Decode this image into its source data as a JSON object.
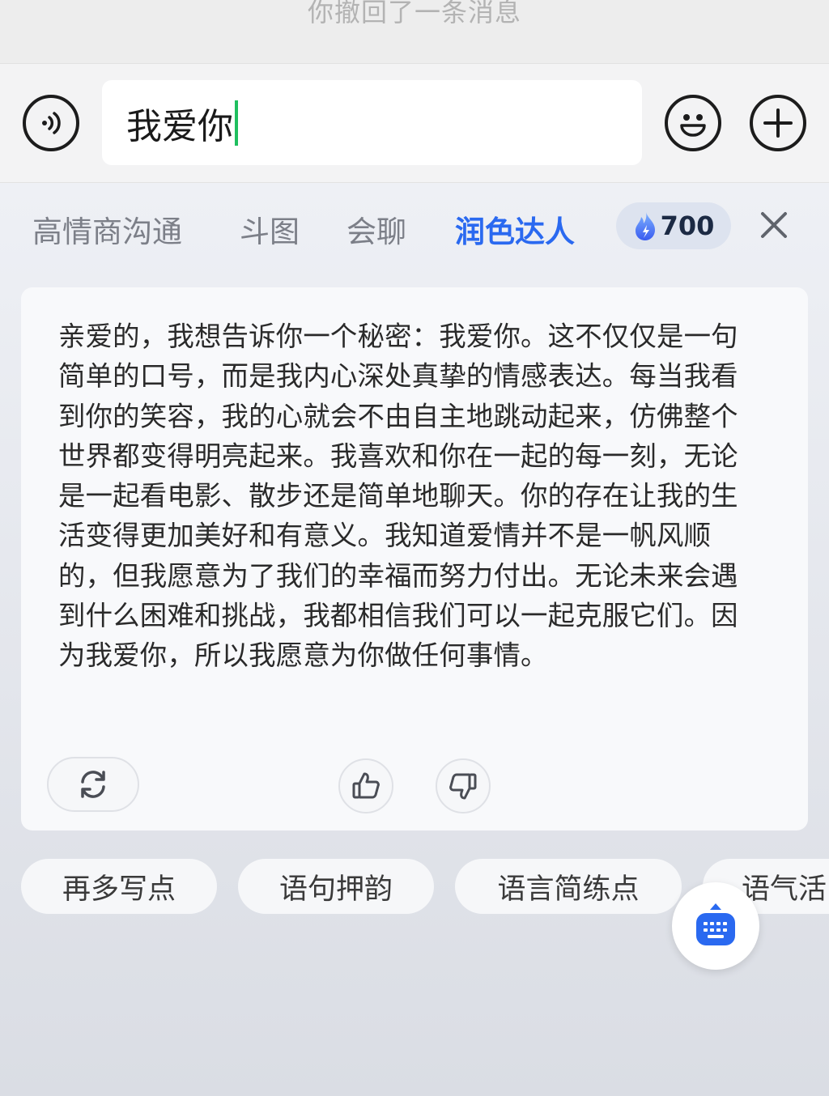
{
  "chat": {
    "system_message": "你撤回了一条消息"
  },
  "input": {
    "value": "我爱你"
  },
  "icons": {
    "voice": "voice-icon",
    "emoji": "emoji-icon",
    "plus": "plus-icon",
    "flame": "flame-icon",
    "close": "close-icon",
    "refresh": "refresh-icon",
    "thumbs_up": "thumbs-up-icon",
    "thumbs_down": "thumbs-down-icon",
    "keyboard": "keyboard-icon"
  },
  "ai_tabs": {
    "items": [
      "高情商沟通",
      "斗图",
      "会聊",
      "润色达人"
    ],
    "active_index": 3,
    "credits": "700"
  },
  "result": {
    "text": "亲爱的，我想告诉你一个秘密：我爱你。这不仅仅是一句简单的口号，而是我内心深处真挚的情感表达。每当我看到你的笑容，我的心就会不由自主地跳动起来，仿佛整个世界都变得明亮起来。我喜欢和你在一起的每一刻，无论是一起看电影、散步还是简单地聊天。你的存在让我的生活变得更加美好和有意义。我知道爱情并不是一帆风顺的，但我愿意为了我们的幸福而努力付出。无论未来会遇到什么困难和挑战，我都相信我们可以一起克服它们。因为我爱你，所以我愿意为你做任何事情。"
  },
  "suggestions": [
    "再多写点",
    "语句押韵",
    "语言简练点",
    "语气活"
  ],
  "colors": {
    "accent": "#2a69f0",
    "cursor": "#1fbf5f",
    "tab_inactive": "#7c7f88",
    "card_bg": "#f8f9fb"
  }
}
